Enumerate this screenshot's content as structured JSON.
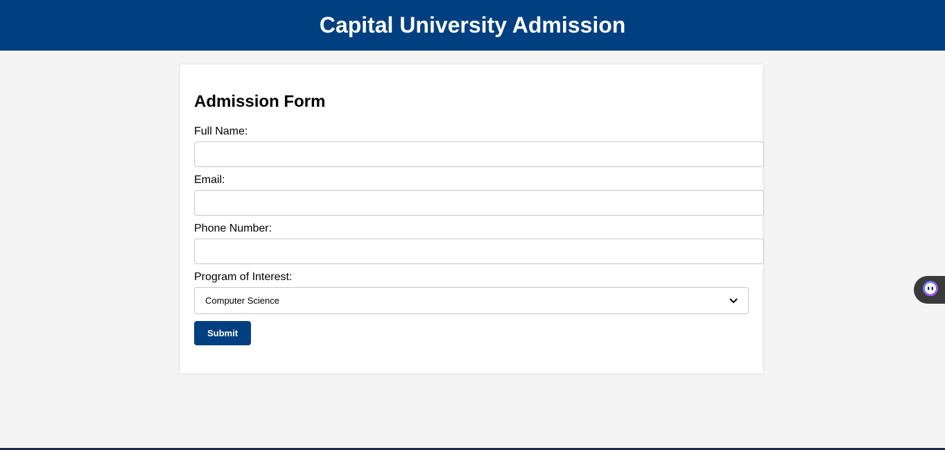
{
  "header": {
    "title": "Capital University Admission"
  },
  "form": {
    "title": "Admission Form",
    "fields": [
      {
        "label": "Full Name:",
        "value": "",
        "placeholder": ""
      },
      {
        "label": "Email:",
        "value": "",
        "placeholder": ""
      },
      {
        "label": "Phone Number:",
        "value": "",
        "placeholder": ""
      }
    ],
    "program": {
      "label": "Program of Interest:",
      "selected": "Computer Science"
    },
    "submit_label": "Submit"
  },
  "colors": {
    "brand": "#003f80",
    "background": "#f4f4f4",
    "card": "#ffffff"
  },
  "icons": {
    "select_arrow": "chevron-down-icon",
    "widget": "assistant-bot-icon"
  }
}
